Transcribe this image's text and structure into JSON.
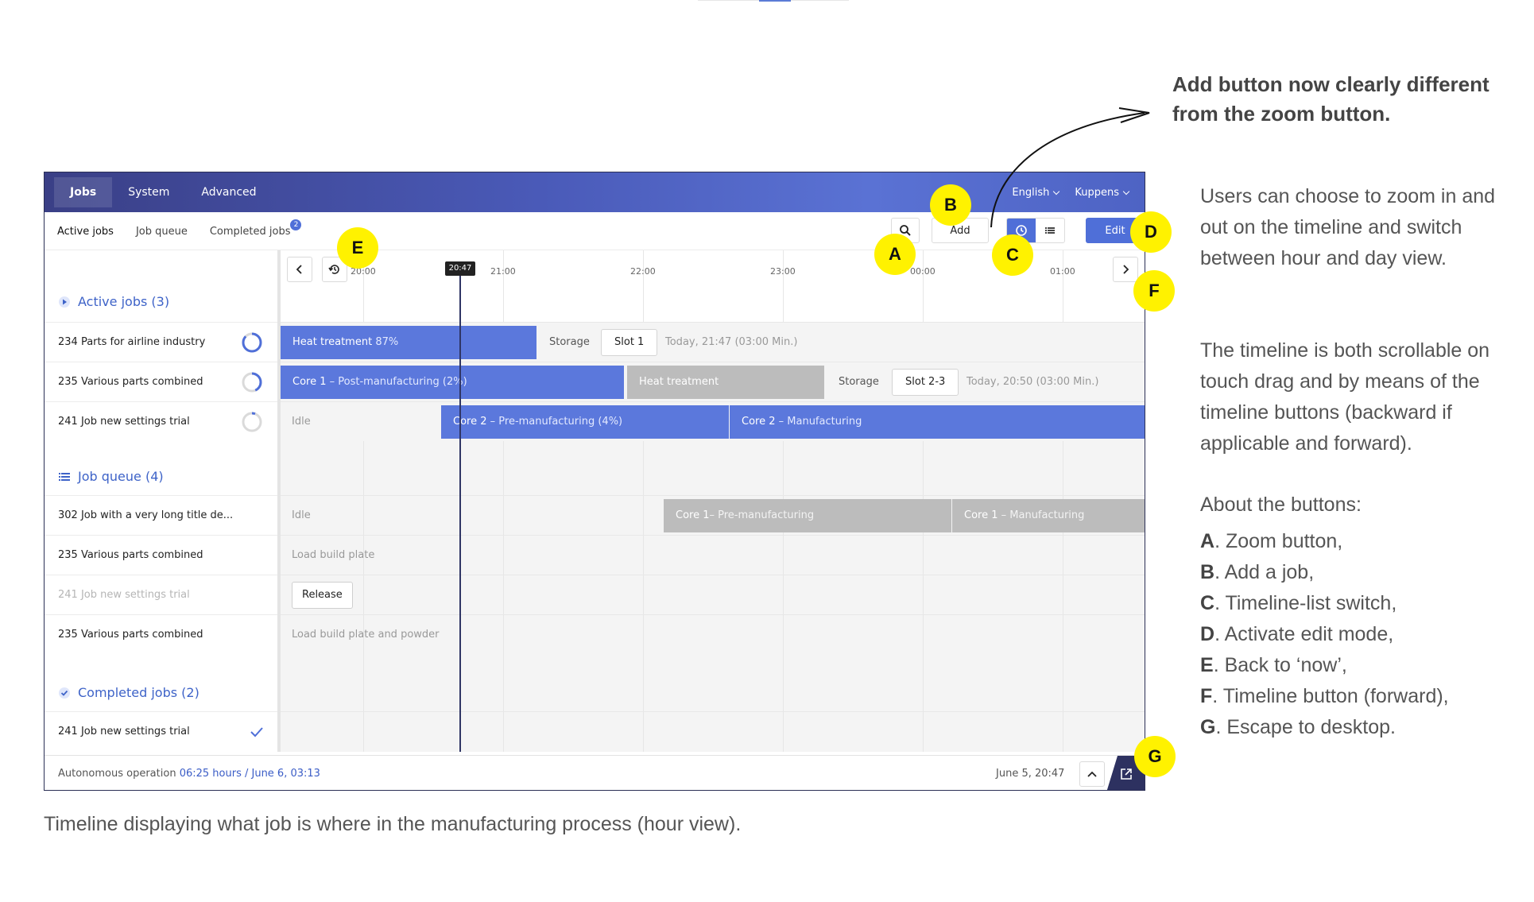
{
  "topnav": {
    "items": [
      "Jobs",
      "System",
      "Advanced"
    ],
    "language": "English",
    "user": "Kuppens"
  },
  "subtabs": {
    "active": "Active jobs",
    "queue": "Job queue",
    "completed": "Completed jobs",
    "completed_badge": "2"
  },
  "toolbar": {
    "add_label": "Add",
    "edit_label": "Edit",
    "zoom_icon": "search-icon",
    "timeline_icon": "clock-icon",
    "list_icon": "list-icon"
  },
  "timeline": {
    "hours": [
      "20:00",
      "21:00",
      "22:00",
      "23:00",
      "00:00",
      "01:00"
    ],
    "now": "20:47",
    "back_icon": "chevron-left-icon",
    "now_icon": "history-icon",
    "forward_icon": "chevron-right-icon"
  },
  "sections": {
    "active": "Active jobs (3)",
    "queue": "Job queue (4)",
    "completed": "Completed jobs (2)"
  },
  "active_jobs": [
    {
      "name": "234 Parts for airline industry",
      "bar1": "Heat treatment",
      "bar1_pct": "87%",
      "storage": "Storage",
      "slot": "Slot 1",
      "eta": "Today,  21:47 (03:00 Min.)"
    },
    {
      "name": "235 Various parts combined",
      "bar1": "Core 1",
      "bar1_pct": "– Post-manufacturing (2%)",
      "bar2": "Heat treatment",
      "storage": "Storage",
      "slot": "Slot 2-3",
      "eta": "Today,  20:50 (03:00 Min.)"
    },
    {
      "name": "241 Job new settings trial",
      "idle": "Idle",
      "bar1": "Core 2",
      "bar1_pct": "– Pre-manufacturing (4%)",
      "bar2": "Core 2",
      "bar2_pct": "– Manufacturing"
    }
  ],
  "queue_jobs": [
    {
      "name": "302 Job with a very long title de...",
      "idle": "Idle",
      "bar1": "Core 1",
      "bar1_pct": "– Pre-manufacturing",
      "bar2": "Core 1",
      "bar2_pct": "– Manufacturing"
    },
    {
      "name": "235 Various parts combined",
      "label": "Load build plate"
    },
    {
      "name": "241 Job new settings trial",
      "button": "Release"
    },
    {
      "name": "235 Various parts combined",
      "label": "Load build plate and powder"
    }
  ],
  "completed_jobs": [
    {
      "name": "241 Job new settings trial"
    }
  ],
  "footer": {
    "status_prefix": "Autonomous operation",
    "status_value": "06:25 hours / June 6, 03:13",
    "date": "June 5, 20:47"
  },
  "callouts": [
    "A",
    "B",
    "C",
    "D",
    "E",
    "F",
    "G"
  ],
  "annotation": {
    "title": "Add button now clearly different from the zoom button.",
    "para1": "Users can choose to zoom in and out on the timeline and switch between hour and day view.",
    "para2": "The timeline is both scrollable on touch drag and by means of the timeline buttons (backward if applicable and forward).",
    "legend_title": "About the buttons:",
    "legend": [
      {
        "key": "A",
        "text": ". Zoom button,"
      },
      {
        "key": "B",
        "text": ". Add a job,"
      },
      {
        "key": "C",
        "text": ". Timeline-list switch,"
      },
      {
        "key": "D",
        "text": ". Activate edit mode,"
      },
      {
        "key": "E",
        "text": ". Back to ‘now’,"
      },
      {
        "key": "F",
        "text": ". Timeline button (forward),"
      },
      {
        "key": "G",
        "text": ". Escape to desktop."
      }
    ]
  },
  "caption": "Timeline displaying what job is where in the manufacturing process (hour view).",
  "colors": {
    "accent": "#4f6fd8",
    "callout": "#fff200",
    "bar_grey": "#bcbcbc",
    "header_dark": "#3a3f86"
  }
}
